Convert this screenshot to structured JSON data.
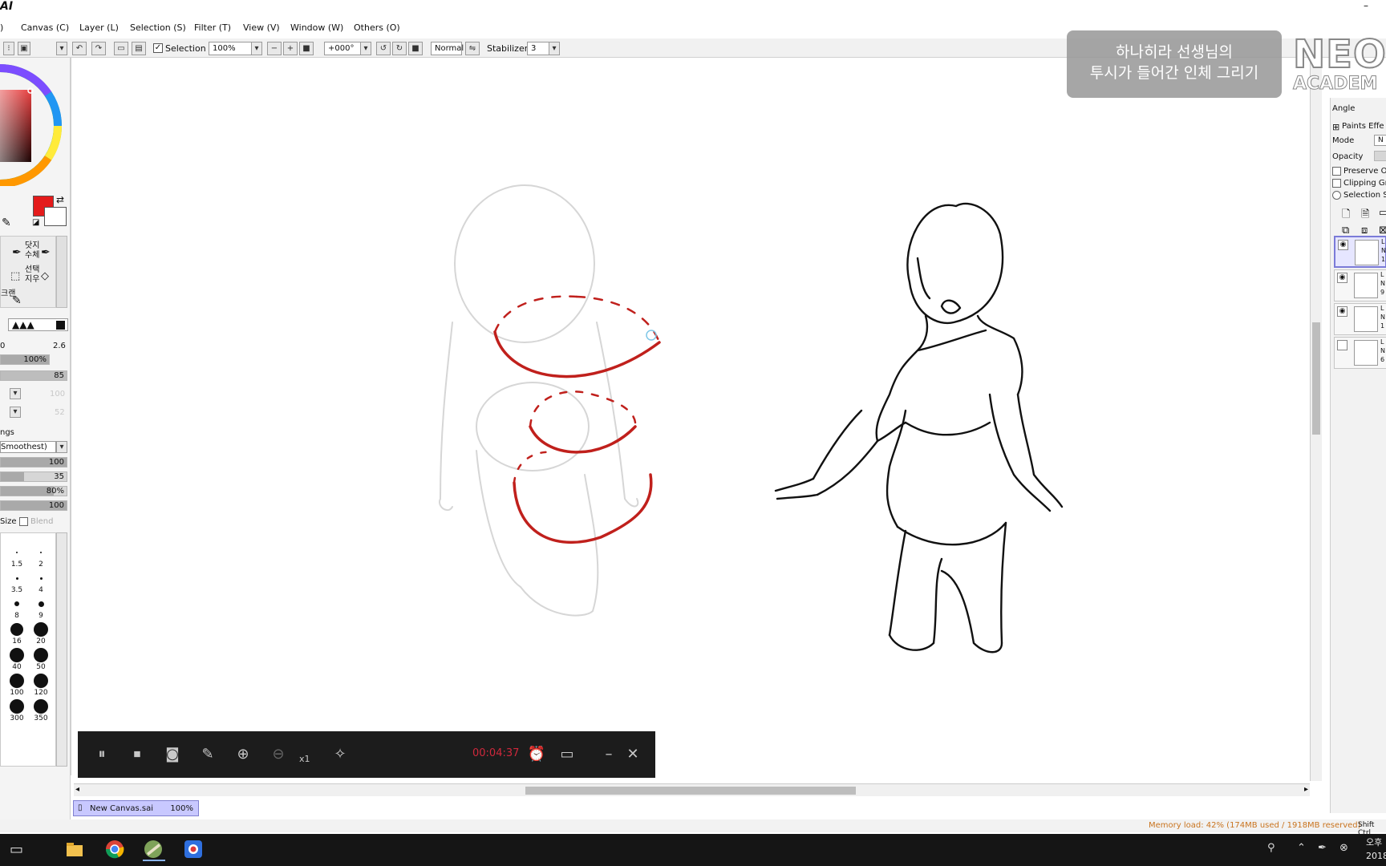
{
  "app": {
    "title": "AI"
  },
  "menu": {
    "items": [
      "Canvas (C)",
      "Layer (L)",
      "Selection (S)",
      "Filter (T)",
      "View (V)",
      "Window (W)",
      "Others (O)"
    ]
  },
  "toolbar": {
    "selection_label": "Selection",
    "zoom_value": "100%",
    "rotation_value": "+000°",
    "blend_mode": "Normal",
    "stabilizer_label": "Stabilizer",
    "stabilizer_value": "3"
  },
  "left_panel": {
    "tool_labels": [
      "닷지",
      "수체",
      "선택",
      "지우",
      "크랜"
    ],
    "min_size": "0",
    "max_size": "2.6",
    "density_value": "100%",
    "value_85": "85",
    "value_100_dim": "100",
    "value_52_dim": "52",
    "settings_label": "ngs",
    "smoothing_option": "Smoothest)",
    "slider_values": [
      "100",
      "35",
      "80%",
      "100"
    ],
    "slider_fills": [
      1.0,
      0.35,
      0.8,
      1.0
    ],
    "size_label": "Size",
    "blend_label": "Blend",
    "brush_sizes": [
      "1.5",
      "2",
      "3.5",
      "4",
      "8",
      "9",
      "16",
      "20",
      "40",
      "50",
      "100",
      "120",
      "300",
      "350"
    ]
  },
  "overlay": {
    "line1": "하나히라 선생님의",
    "line2": "투시가 들어간 인체 그리기",
    "logo_top": "NEO",
    "logo_bottom": "ACADEM"
  },
  "right_panel": {
    "angle_label": "Angle",
    "paint_effects": "Paints Effe",
    "mode_label": "Mode",
    "mode_value": "N",
    "opacity_label": "Opacity",
    "preserve_label": "Preserve O",
    "clipping_label": "Clipping Gro",
    "selection_src_label": "Selection S",
    "layers": [
      {
        "name": "L",
        "mode": "N",
        "opacity": "1",
        "visible": true,
        "active": true
      },
      {
        "name": "L",
        "mode": "N",
        "opacity": "9",
        "visible": true,
        "active": false
      },
      {
        "name": "L",
        "mode": "N",
        "opacity": "1",
        "visible": true,
        "active": false
      },
      {
        "name": "L",
        "mode": "N",
        "opacity": "6",
        "visible": false,
        "active": false
      }
    ]
  },
  "recorder": {
    "time": "00:04:37",
    "speed": "x1"
  },
  "document_tab": {
    "name": "New Canvas.sai",
    "zoom": "100%"
  },
  "status": {
    "memory": "Memory load: 42% (174MB used / 1918MB reserved)",
    "shift_ctrl": "Shift Ctrl"
  },
  "taskbar": {
    "clock_line1": "오후",
    "clock_line2": "2018"
  },
  "colors": {
    "primary_color": "#e41b1b",
    "secondary_color": "#ffffff",
    "stroke_red": "#c0201c",
    "taskbar_bg": "#151515",
    "recorder_bg": "#1c1c1c",
    "memory_text": "#c9741f",
    "layer_active": "#7b7bd8"
  },
  "icons": {
    "toolbar": [
      "undo-icon",
      "redo-icon",
      "deselect-icon",
      "invert-selection-icon",
      "zoom-out-icon",
      "zoom-in-icon",
      "zoom-reset-icon",
      "rotate-left-icon",
      "rotate-right-icon",
      "rotate-reset-icon"
    ],
    "recorder": [
      "pause-icon",
      "stop-icon",
      "screenshot-icon",
      "pen-icon",
      "zoom-in-icon",
      "zoom-out-icon",
      "cursor-effect-icon",
      "alarm-icon",
      "options-icon",
      "minimize-icon",
      "close-icon"
    ],
    "taskbar": [
      "task-view-icon",
      "file-explorer-icon",
      "chrome-icon",
      "sai-icon",
      "recorder-icon"
    ]
  }
}
